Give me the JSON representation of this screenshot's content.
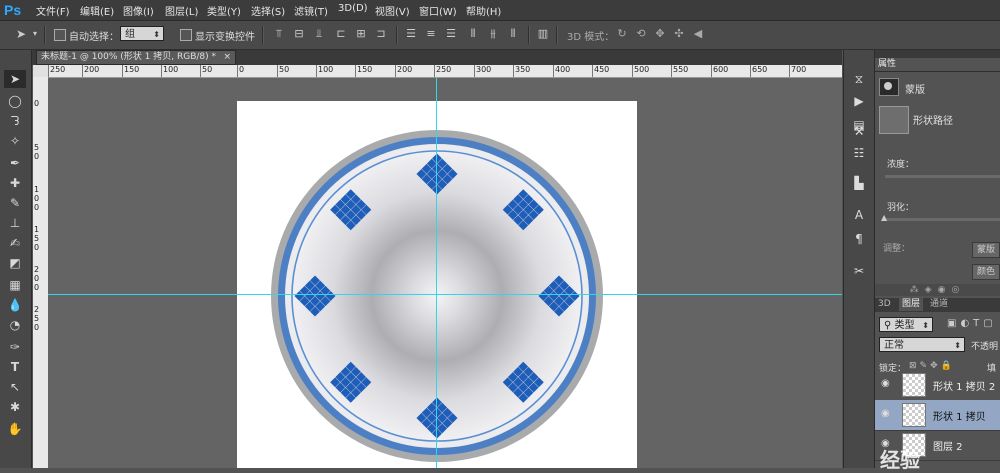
{
  "app": {
    "logo": "Ps"
  },
  "menu": [
    "文件(F)",
    "编辑(E)",
    "图像(I)",
    "图层(L)",
    "类型(Y)",
    "选择(S)",
    "滤镜(T)",
    "3D(D)",
    "视图(V)",
    "窗口(W)",
    "帮助(H)"
  ],
  "options": {
    "auto_select_label": "自动选择：",
    "auto_select_value": "组",
    "show_transform_label": "显示变换控件",
    "mode_3d_label": "3D 模式："
  },
  "document": {
    "tab_title": "未标题-1 @ 100% (形状 1 拷贝, RGB/8) *",
    "close_glyph": "×"
  },
  "ruler": {
    "h_labels": [
      "250",
      "200",
      "150",
      "100",
      "50",
      "0",
      "50",
      "100",
      "150",
      "200",
      "250",
      "300",
      "350",
      "400",
      "450",
      "500",
      "550",
      "600",
      "650",
      "700"
    ],
    "v_labels": [
      "0",
      "5",
      "0",
      "1",
      "0",
      "0",
      "1",
      "5",
      "0",
      "2",
      "0",
      "0",
      "2",
      "5",
      "0"
    ]
  },
  "properties": {
    "tab": "属性",
    "mask_label": "蒙版",
    "shape_path_label": "形状路径",
    "density_label": "浓度：",
    "feather_label": "羽化：",
    "adjust_label": "调整：",
    "btn_mask_edge": "蒙版",
    "btn_color": "颜色"
  },
  "layers": {
    "tabs": [
      "3D",
      "图层",
      "通道"
    ],
    "filter_kind": "类型",
    "blend_mode": "正常",
    "opacity_label": "不透明",
    "lock_label": "锁定：",
    "fill_label": "填",
    "items": [
      {
        "name": "形状 1 拷贝 2",
        "selected": false
      },
      {
        "name": "形状 1 拷贝",
        "selected": true
      },
      {
        "name": "图层 2",
        "selected": false
      }
    ]
  },
  "watermark": "经验",
  "colors": {
    "guide": "#33d6e6",
    "rim_outer": "#a8aaab",
    "ring_blue": "#4d7fc4",
    "inner_line": "#5a8fd4",
    "pattern_blue": "#1f5eb8",
    "selected_layer": "#93a7c5"
  }
}
